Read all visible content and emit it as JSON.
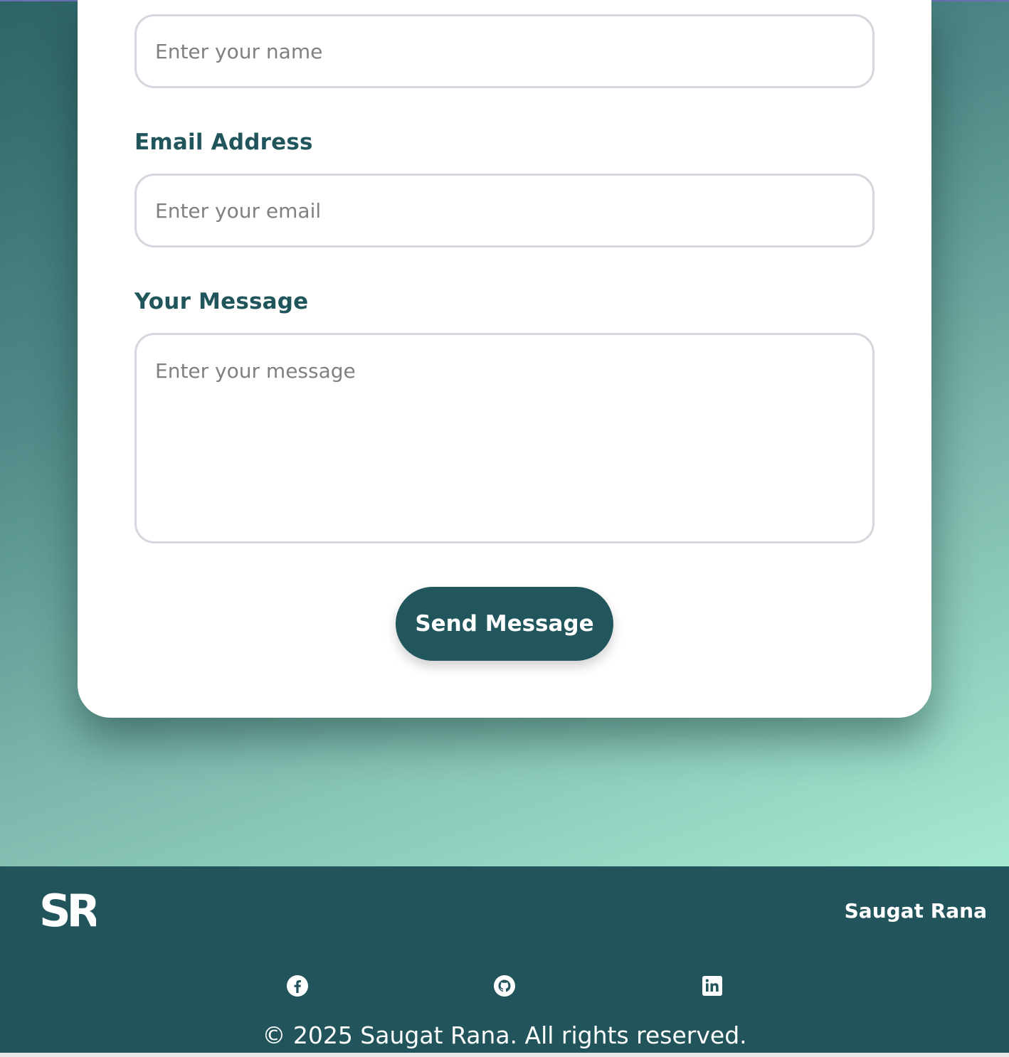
{
  "form": {
    "name_placeholder": "Enter your name",
    "email_label": "Email Address",
    "email_placeholder": "Enter your email",
    "message_label": "Your Message",
    "message_placeholder": "Enter your message",
    "submit_label": "Send Message"
  },
  "footer": {
    "logo_text": "SR",
    "owner_name": "Saugat Rana",
    "social": [
      {
        "icon": "facebook-icon"
      },
      {
        "icon": "github-icon"
      },
      {
        "icon": "linkedin-icon"
      }
    ],
    "copyright": "© 2025 Saugat Rana. All rights reserved."
  },
  "colors": {
    "accent": "#22565d",
    "footer_bg": "#22555b",
    "label": "#1f555b",
    "gradient_start": "#2d6466",
    "gradient_end": "#a6e9d2"
  }
}
